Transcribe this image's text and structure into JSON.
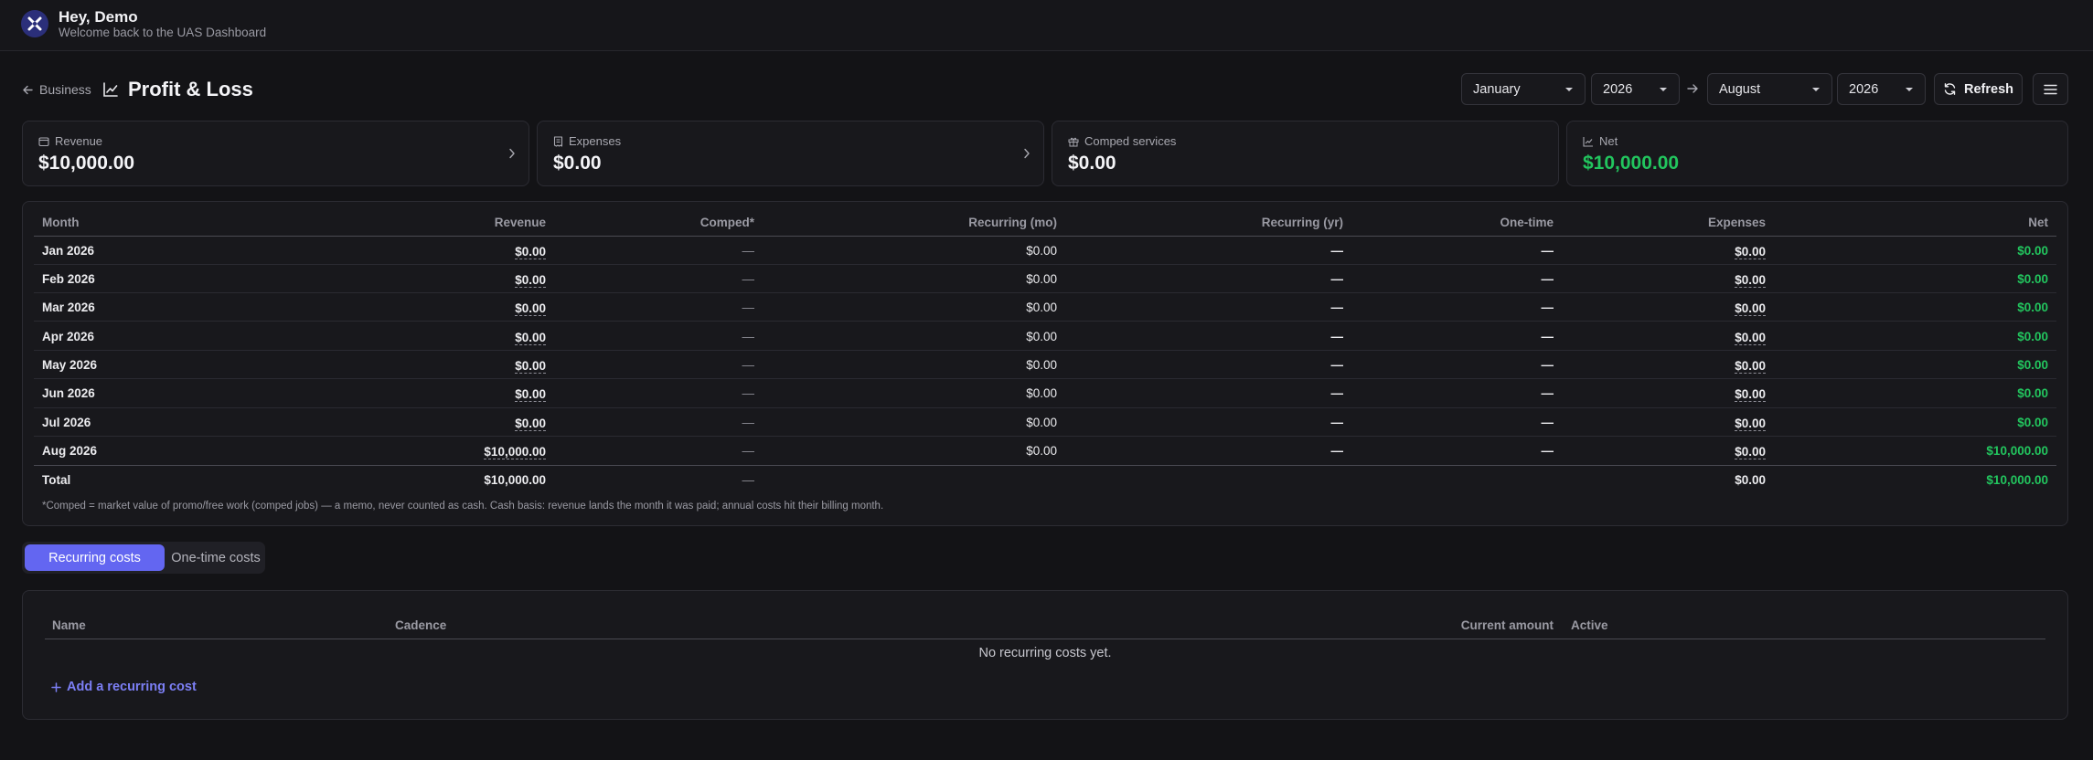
{
  "header": {
    "greeting": "Hey, Demo",
    "subtitle": "Welcome back to the UAS Dashboard"
  },
  "nav": {
    "back_label": "Business",
    "page_title": "Profit & Loss"
  },
  "filters": {
    "from_month": "January",
    "from_year": "2026",
    "to_month": "August",
    "to_year": "2026",
    "refresh_label": "Refresh"
  },
  "cards": {
    "revenue": {
      "label": "Revenue",
      "value": "$10,000.00"
    },
    "expenses": {
      "label": "Expenses",
      "value": "$0.00"
    },
    "comped": {
      "label": "Comped services",
      "value": "$0.00"
    },
    "net": {
      "label": "Net",
      "value": "$10,000.00"
    }
  },
  "monthly_table": {
    "columns": [
      "Month",
      "Revenue",
      "Comped*",
      "Recurring (mo)",
      "Recurring (yr)",
      "One-time",
      "Expenses",
      "Net"
    ],
    "rows": [
      [
        "Jan 2026",
        "$0.00",
        "—",
        "$0.00",
        "—",
        "—",
        "$0.00",
        "$0.00"
      ],
      [
        "Feb 2026",
        "$0.00",
        "—",
        "$0.00",
        "—",
        "—",
        "$0.00",
        "$0.00"
      ],
      [
        "Mar 2026",
        "$0.00",
        "—",
        "$0.00",
        "—",
        "—",
        "$0.00",
        "$0.00"
      ],
      [
        "Apr 2026",
        "$0.00",
        "—",
        "$0.00",
        "—",
        "—",
        "$0.00",
        "$0.00"
      ],
      [
        "May 2026",
        "$0.00",
        "—",
        "$0.00",
        "—",
        "—",
        "$0.00",
        "$0.00"
      ],
      [
        "Jun 2026",
        "$0.00",
        "—",
        "$0.00",
        "—",
        "—",
        "$0.00",
        "$0.00"
      ],
      [
        "Jul 2026",
        "$0.00",
        "—",
        "$0.00",
        "—",
        "—",
        "$0.00",
        "$0.00"
      ],
      [
        "Aug 2026",
        "$10,000.00",
        "—",
        "$0.00",
        "—",
        "—",
        "$0.00",
        "$10,000.00"
      ]
    ],
    "total": [
      "Total",
      "$10,000.00",
      "—",
      "",
      "",
      "",
      "$0.00",
      "$10,000.00"
    ],
    "footnote": "*Comped = market value of promo/free work (comped jobs) — a memo, never counted as cash. Cash basis: revenue lands the month it was paid; annual costs hit their billing month."
  },
  "tabs": [
    {
      "label": "Recurring costs",
      "active": true
    },
    {
      "label": "One-time costs",
      "active": false
    }
  ],
  "costs_table": {
    "columns": [
      "Name",
      "Cadence",
      "Current amount",
      "Active"
    ],
    "empty_message": "No recurring costs yet.",
    "add_label": "Add a recurring cost"
  },
  "colors": {
    "accent": "#6366f1",
    "positive": "#22c55e",
    "background": "#131316"
  }
}
